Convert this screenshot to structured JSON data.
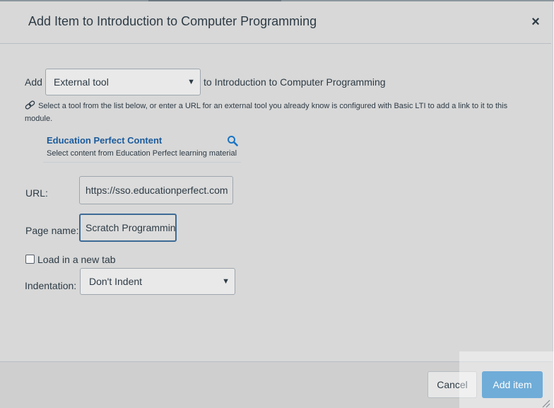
{
  "dialog": {
    "title": "Add Item to Introduction to Computer Programming",
    "close_label": "×"
  },
  "add_row": {
    "add_label": "Add",
    "type_selected": "External tool",
    "to_label": "to Introduction to Computer Programming"
  },
  "help_text": "Select a tool from the list below, or enter a URL for an external tool you already know is configured with Basic LTI to add a link to it to this module.",
  "tool": {
    "name": "Education Perfect Content",
    "description": "Select content from Education Perfect learning material"
  },
  "form": {
    "url_label": "URL:",
    "url_value": "https://sso.educationperfect.com",
    "page_name_label": "Page name:",
    "page_name_value": "Scratch Programming",
    "new_tab_label": "Load in a new tab",
    "new_tab_checked": false,
    "indentation_label": "Indentation:",
    "indentation_selected": "Don't Indent"
  },
  "footer": {
    "cancel_label": "Cancel",
    "add_label": "Add item"
  },
  "colors": {
    "primary_button": "#0770bc",
    "tool_link": "#1a5b9c",
    "text": "#2d3b45",
    "overlay": "#d8d8d8"
  },
  "icons": [
    "close-icon",
    "chevron-down-icon",
    "link-icon",
    "search-icon",
    "resize-handle-icon"
  ]
}
